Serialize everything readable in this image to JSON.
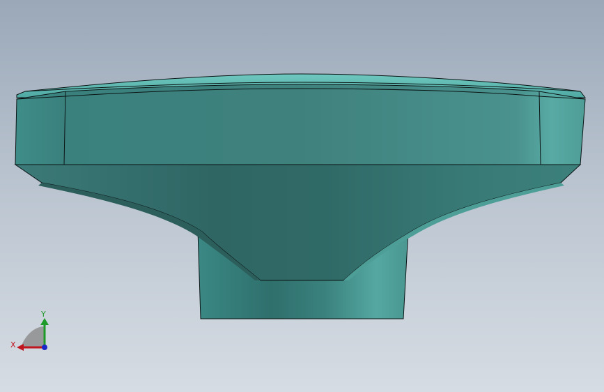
{
  "viewport": {
    "background_top": "#9aa8b8",
    "background_bottom": "#d6dce3"
  },
  "model": {
    "face_color": "#3f8a87",
    "edge_color": "#0a1414",
    "highlight_color": "#55b3ac"
  },
  "triad": {
    "x_label": "X",
    "y_label": "Y",
    "x_color": "#c0141e",
    "y_color": "#1e9a28",
    "z_color": "#1a28c8",
    "icon": "coordinate-triad-icon"
  }
}
